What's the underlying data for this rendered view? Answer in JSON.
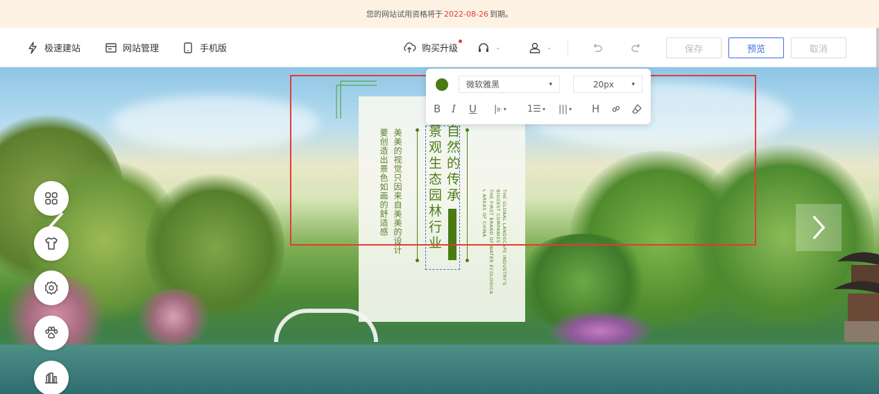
{
  "banner": {
    "prefix": "您的网站试用资格将于",
    "date": "2022-08-26",
    "suffix": "到期。"
  },
  "toolbar": {
    "left_items": [
      {
        "label": "极速建站",
        "icon": "lightning-icon"
      },
      {
        "label": "网站管理",
        "icon": "website-manage-icon"
      },
      {
        "label": "手机版",
        "icon": "mobile-icon"
      }
    ],
    "upgrade_label": "购买升级",
    "save_label": "保存",
    "preview_label": "预览",
    "cancel_label": "取消"
  },
  "format_toolbar": {
    "color": "#4a7a14",
    "font": "微软雅黑",
    "size": "20px",
    "buttons": [
      "bold-icon",
      "italic-icon",
      "underline-icon",
      "align-icon",
      "list-icon",
      "letter-spacing-icon",
      "heading-icon",
      "link-icon",
      "eraser-icon"
    ]
  },
  "content": {
    "title_col1": "自然的传承",
    "title_col2": "景观生态园林行业",
    "subtitle_col1": "美美的视觉只因来自美美的设计",
    "subtitle_col2": "要创造出景色如画的舒适感",
    "english_lines": [
      "THE GLOBAL LANDSCAPE INDUSTRY'S",
      "BIGGEST COMPANIES",
      "THE FIRST BRAND OF WATER ECOLOGICA",
      "L AREAS OF CHINA"
    ]
  },
  "side_tools": [
    "grid-icon",
    "theme-shirt-icon",
    "settings-icon",
    "paw-icon",
    "building-icon"
  ],
  "colors": {
    "accent": "#3d6fd8",
    "selection": "#e53935",
    "deadline": "#e4393c",
    "text_green": "#4d7d1a"
  }
}
